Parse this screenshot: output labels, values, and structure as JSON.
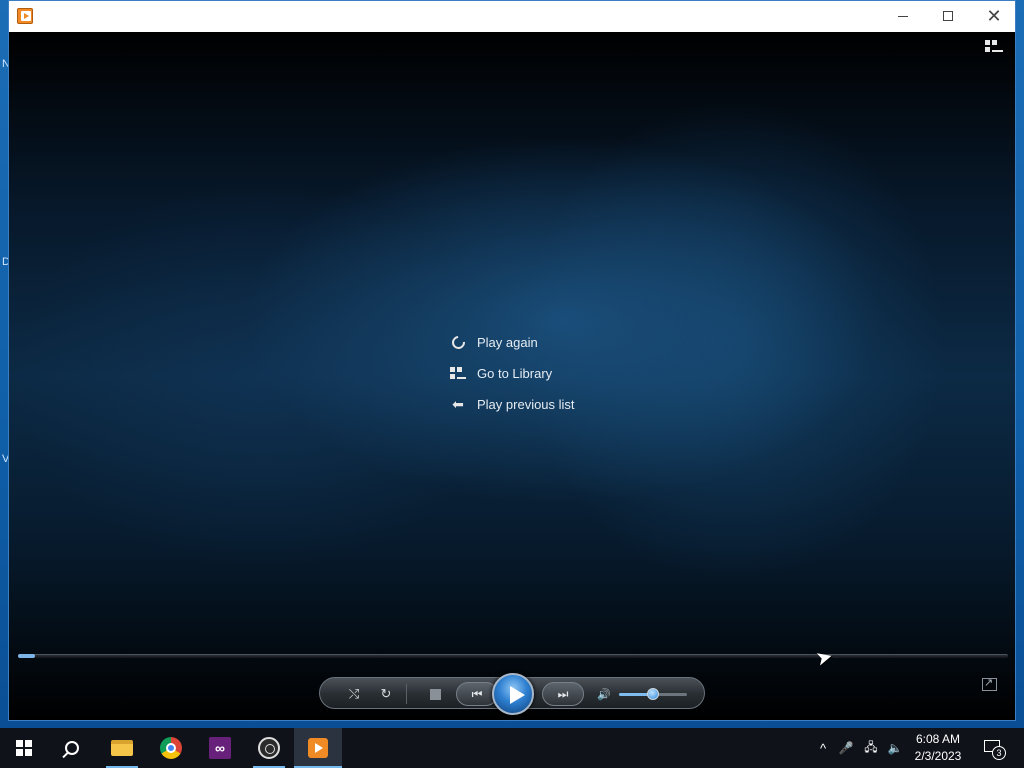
{
  "desktop": {
    "edge_glyphs": [
      "N",
      "D",
      "V"
    ]
  },
  "window": {
    "title": "",
    "controls": {
      "minimize": "—",
      "maximize": "□",
      "close": "✕"
    }
  },
  "player": {
    "menu": [
      {
        "label": "Play again",
        "icon": "replay-icon"
      },
      {
        "label": "Go to Library",
        "icon": "library-icon"
      },
      {
        "label": "Play previous list",
        "icon": "back-arrow-icon"
      }
    ],
    "seek_progress": 0.017,
    "volume_level": 0.5,
    "glyphs": {
      "shuffle": "⤭",
      "repeat": "↻",
      "previous": "⏮",
      "next": "⏭",
      "mute": "🔊",
      "back_arrow": "⬅"
    }
  },
  "taskbar": {
    "apps": [
      {
        "name": "start",
        "icon": "windows-icon"
      },
      {
        "name": "search",
        "icon": "search-icon"
      },
      {
        "name": "file-explorer",
        "icon": "folder-icon"
      },
      {
        "name": "chrome",
        "icon": "chrome-icon"
      },
      {
        "name": "visual-studio",
        "icon": "visual-studio-icon"
      },
      {
        "name": "obs",
        "icon": "obs-icon"
      },
      {
        "name": "windows-media-player",
        "icon": "media-player-icon"
      }
    ],
    "tray": {
      "chevron": "^",
      "mic": "🎤",
      "network": "🖧",
      "volume": "🔈"
    },
    "clock": {
      "time": "6:08 AM",
      "date": "2/3/2023"
    },
    "notifications": {
      "count": "3"
    }
  },
  "colors": {
    "accent": "#76b9ed",
    "play_button": "#2e7fd0",
    "app_icon": "#f08a24"
  }
}
